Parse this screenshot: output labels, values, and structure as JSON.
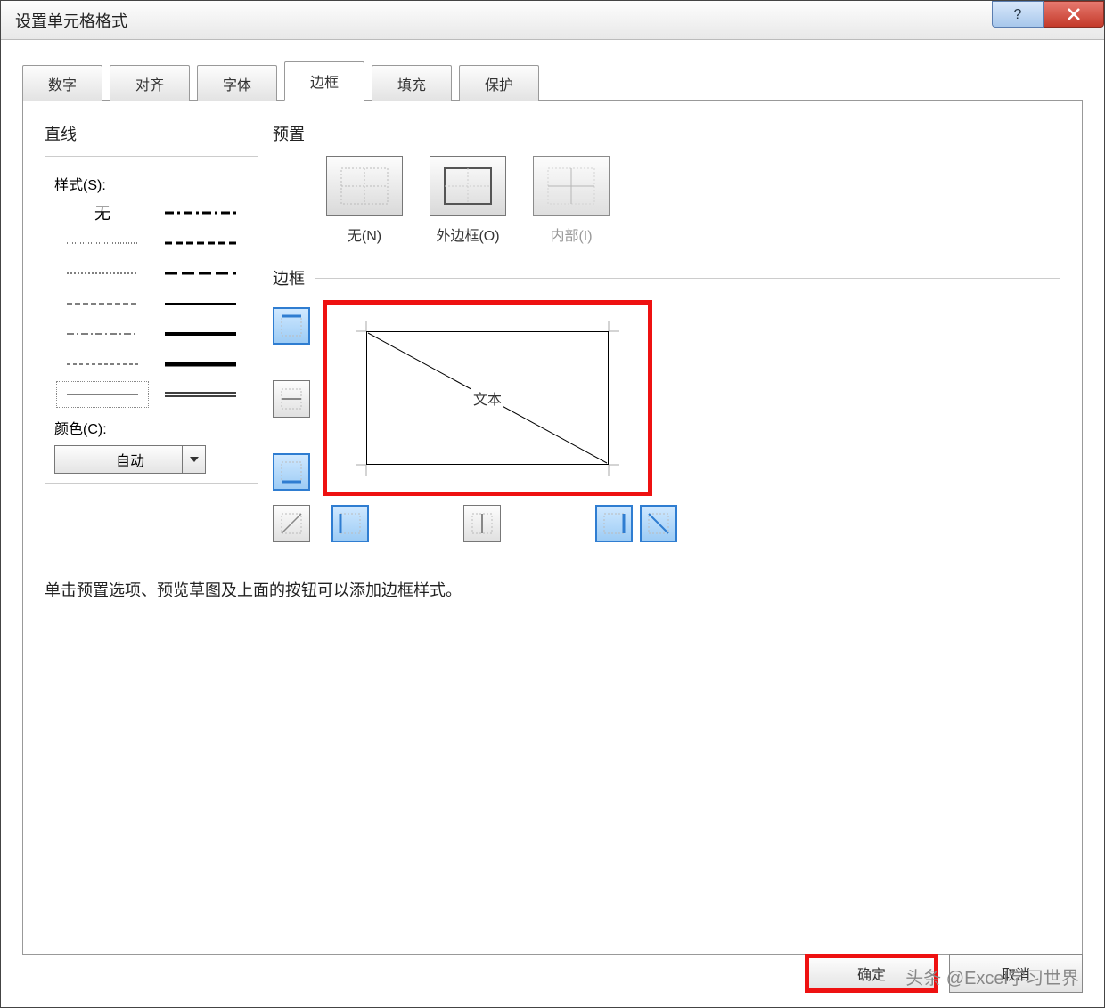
{
  "dialog": {
    "title": "设置单元格格式"
  },
  "tabs": {
    "items": [
      {
        "label": "数字"
      },
      {
        "label": "对齐"
      },
      {
        "label": "字体"
      },
      {
        "label": "边框"
      },
      {
        "label": "填充"
      },
      {
        "label": "保护"
      }
    ],
    "active_index": 3
  },
  "line_group": {
    "title": "直线",
    "style_label": "样式(S):",
    "none_label": "无",
    "color_label": "颜色(C):",
    "color_value": "自动"
  },
  "preset_group": {
    "title": "预置",
    "items": [
      {
        "label": "无(N)"
      },
      {
        "label": "外边框(O)"
      },
      {
        "label": "内部(I)"
      }
    ]
  },
  "border_group": {
    "title": "边框",
    "preview_text": "文本"
  },
  "hint_text": "单击预置选项、预览草图及上面的按钮可以添加边框样式。",
  "buttons": {
    "ok": "确定",
    "cancel": "取消"
  },
  "watermark": "头条 @Excel学习世界"
}
